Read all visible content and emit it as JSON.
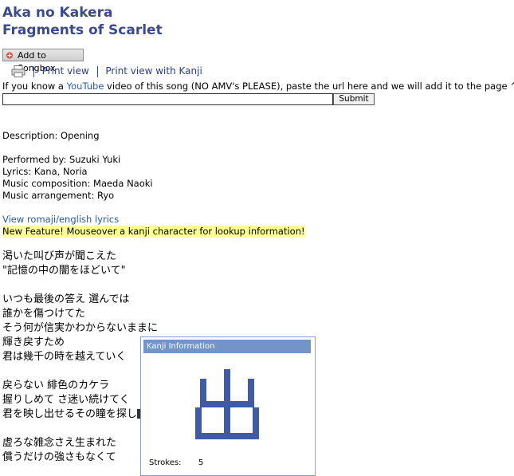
{
  "header": {
    "title_romaji": "Aka no Kakera",
    "title_english": "Fragments of Scarlet"
  },
  "toolbar": {
    "songbox_label": "Add to Songbox",
    "print_view": "Print view",
    "print_view_kanji": "Print view with Kanji"
  },
  "youtube": {
    "text_before": "If you know a ",
    "link": "YouTube",
    "text_after": " video of this song (NO AMV's PLEASE), paste the url here and we will add it to the page ^_^",
    "input_value": "",
    "submit_label": "Submit"
  },
  "info": {
    "description": "Description: Opening",
    "performed_by": "Performed by: Suzuki Yuki",
    "lyrics": "Lyrics: Kana, Noria",
    "composition": "Music composition: Maeda Naoki",
    "arrangement": "Music arrangement: Ryo"
  },
  "links": {
    "romaji_english": "View romaji/english lyrics",
    "new_feature": "New Feature! Mouseover a kanji character for lookup information!"
  },
  "lyrics_lines": [
    "渇いた叫び声が聞こえた",
    "\"記憶の中の闇をほどいて\"",
    "いつも最後の答え 選んでは",
    "誰かを傷つけてた",
    "そう何が信実かわからないままに",
    "輝き戻すため",
    "君は幾千の時を越えていく",
    "戻らない 緋色のカケラ",
    "握りしめて さ迷い続けてく",
    "君を映し出せるその瞳を探し",
    "虚ろな雑念さえ生まれた",
    "償うだけの強さもなくて"
  ],
  "kanji_popup": {
    "header": "Kanji Information",
    "kanji": "出",
    "strokes_label": "Strokes:",
    "strokes_value": "5"
  },
  "colors": {
    "title": "#3b4a8c",
    "link": "#2a5aa0",
    "highlight": "#ffff99",
    "popup_header": "#7294c7",
    "kanji": "#3f5ba8"
  }
}
